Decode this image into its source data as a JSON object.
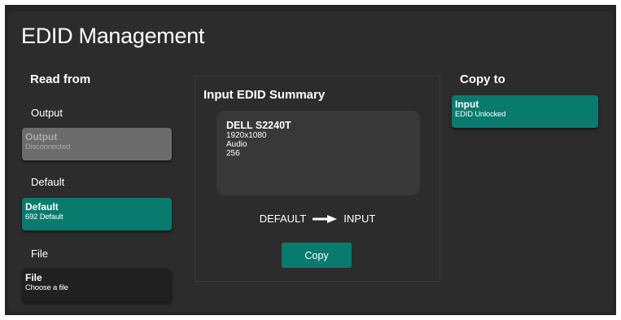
{
  "title": "EDID Management",
  "read_from": {
    "heading": "Read from",
    "groups": [
      {
        "label": "Output",
        "tile": {
          "name": "Output",
          "status": "Disconnected",
          "state": "disabled"
        }
      },
      {
        "label": "Default",
        "tile": {
          "name": "Default",
          "status": "692 Default",
          "state": "selected"
        }
      },
      {
        "label": "File",
        "tile": {
          "name": "File",
          "status": "Choose a file",
          "state": "normal"
        }
      }
    ]
  },
  "summary": {
    "heading": "Input EDID Summary",
    "device": "DELL S2240T",
    "resolution": "1920x1080",
    "audio": "Audio",
    "size": "256",
    "flow_from": "DEFAULT",
    "flow_to": "INPUT",
    "copy_label": "Copy"
  },
  "copy_to": {
    "heading": "Copy to",
    "tile": {
      "name": "Input",
      "status": "EDID Unlocked",
      "state": "selected"
    }
  },
  "colors": {
    "background": "#2c2c2c",
    "accent": "#097b6e",
    "disabled": "#6c6c6c",
    "tile": "#202020"
  },
  "icons": {
    "flow": "arrow-right-icon"
  }
}
